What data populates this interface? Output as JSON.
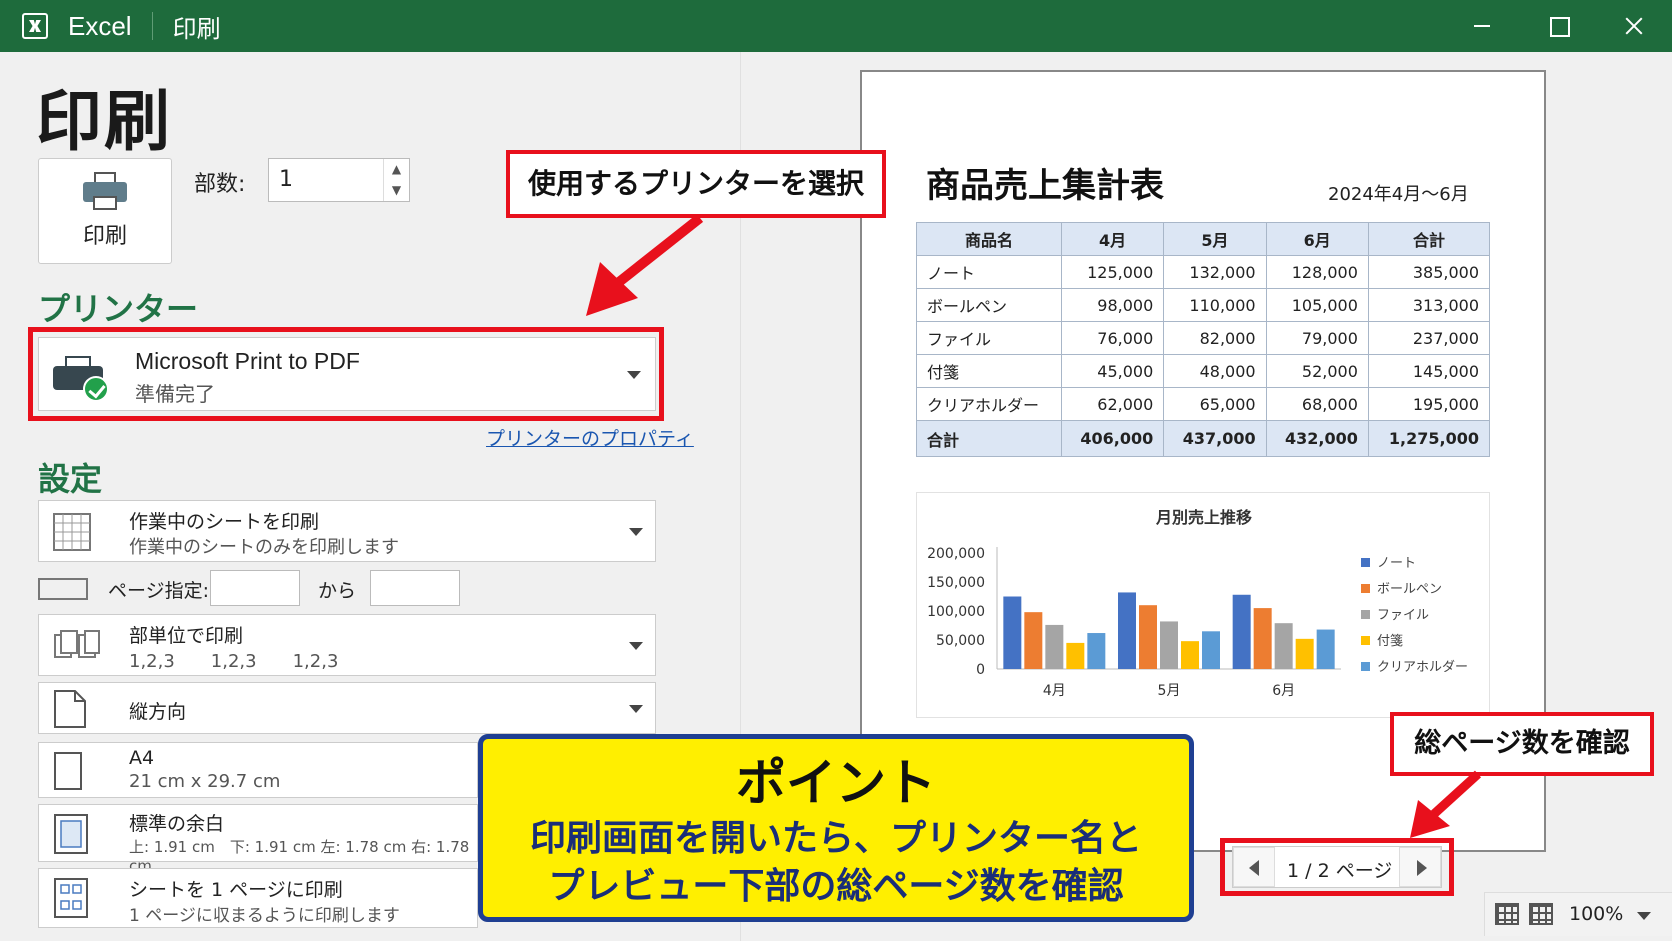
{
  "titlebar": {
    "app_name": "Excel",
    "doc_title": "印刷"
  },
  "page_title": "印刷",
  "print_button": {
    "label": "印刷"
  },
  "copies": {
    "label": "部数:",
    "value": "1"
  },
  "printer_section": {
    "title": "プリンター",
    "selected_name": "Microsoft Print to PDF",
    "status": "準備完了",
    "properties_link": "プリンターのプロパティ"
  },
  "settings_section": {
    "title": "設定",
    "print_what": {
      "title": "作業中のシートを印刷",
      "desc": "作業中のシートのみを印刷します"
    },
    "pages": {
      "label": "ページ指定:",
      "from_value": "",
      "to_label": "から",
      "to_value": ""
    },
    "collate": {
      "title": "部単位で印刷",
      "desc": "1,2,3　　1,2,3　　1,2,3"
    },
    "orientation": {
      "title": "縦方向"
    },
    "paper_size": {
      "title": "A4",
      "desc": "21 cm x 29.7 cm"
    },
    "margins": {
      "title": "標準の余白",
      "desc": "上: 1.91 cm　下: 1.91 cm 左: 1.78 cm 右: 1.78 cm"
    },
    "scaling": {
      "title": "シートを 1 ページに印刷",
      "desc": "1 ページに収まるように印刷します"
    }
  },
  "preview": {
    "doc_title": "商品売上集計表",
    "period": "2024年4月〜6月",
    "table": {
      "headers": [
        "商品名",
        "4月",
        "5月",
        "6月",
        "合計"
      ],
      "rows": [
        [
          "ノート",
          "125,000",
          "132,000",
          "128,000",
          "385,000"
        ],
        [
          "ボールペン",
          "98,000",
          "110,000",
          "105,000",
          "313,000"
        ],
        [
          "ファイル",
          "76,000",
          "82,000",
          "79,000",
          "237,000"
        ],
        [
          "付箋",
          "45,000",
          "48,000",
          "52,000",
          "145,000"
        ],
        [
          "クリアホルダー",
          "62,000",
          "65,000",
          "68,000",
          "195,000"
        ]
      ],
      "total": [
        "合計",
        "406,000",
        "437,000",
        "432,000",
        "1,275,000"
      ]
    },
    "pager": {
      "text": "1 / 2 ページ"
    }
  },
  "chart_data": {
    "type": "bar",
    "title": "月別売上推移",
    "categories": [
      "4月",
      "5月",
      "6月"
    ],
    "series": [
      {
        "name": "ノート",
        "values": [
          125000,
          132000,
          128000
        ],
        "color": "#4472c4"
      },
      {
        "name": "ボールペン",
        "values": [
          98000,
          110000,
          105000
        ],
        "color": "#ed7d31"
      },
      {
        "name": "ファイル",
        "values": [
          76000,
          82000,
          79000
        ],
        "color": "#a5a5a5"
      },
      {
        "name": "付箋",
        "values": [
          45000,
          48000,
          52000
        ],
        "color": "#ffc000"
      },
      {
        "name": "クリアホルダー",
        "values": [
          62000,
          65000,
          68000
        ],
        "color": "#5b9bd5"
      }
    ],
    "ylim": [
      0,
      200000
    ],
    "yticks": [
      "0",
      "50,000",
      "100,000",
      "150,000",
      "200,000"
    ],
    "legend": "right",
    "grid": false
  },
  "status_bar": {
    "zoom": "100%"
  },
  "callouts": {
    "printer": "使用するプリンターを選択",
    "pages": "総ページ数を確認",
    "point_title": "ポイント",
    "point_line1": "印刷画面を開いたら、プリンター名と",
    "point_line2": "プレビュー下部の総ページ数を確認"
  },
  "colors": {
    "titlebar": "#1e6b3c",
    "accent_green": "#217346",
    "highlight_red": "#e8101c",
    "point_yellow": "#ffef00",
    "point_border": "#1f3f92"
  }
}
